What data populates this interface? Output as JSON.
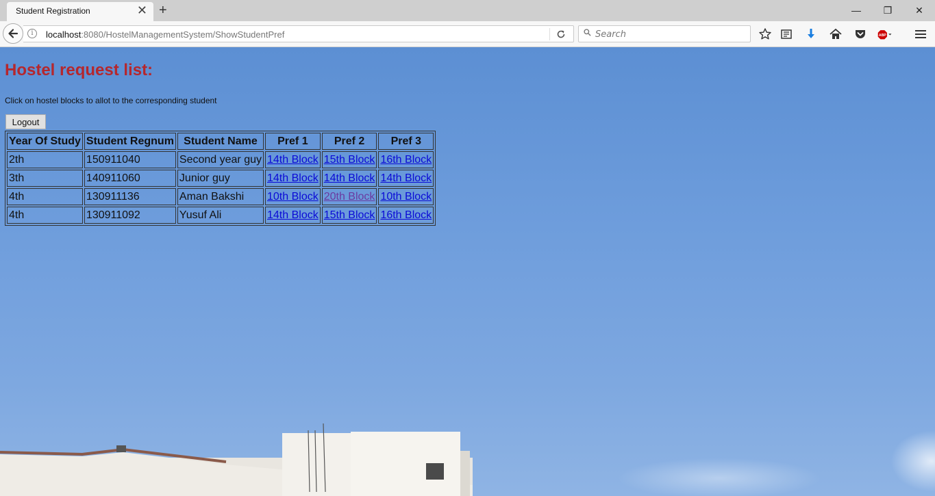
{
  "browser": {
    "tab_title": "Student Registration",
    "tab_close": "✕",
    "new_tab": "+",
    "window_controls": {
      "minimize": "—",
      "restore": "❐",
      "close": "✕"
    },
    "url_host": "localhost",
    "url_rest": ":8080/HostelManagementSystem/ShowStudentPref",
    "search_placeholder": "Search",
    "toolbar_icons": [
      "bookmark-star-icon",
      "reading-list-icon",
      "download-icon",
      "home-icon",
      "pocket-icon",
      "adblock-plus-icon",
      "menu-icon"
    ]
  },
  "page": {
    "title": "Hostel request list:",
    "instructions": "Click on hostel blocks to allot to the corresponding student",
    "logout_label": "Logout",
    "table": {
      "headers": [
        "Year Of Study",
        "Student Regnum",
        "Student Name",
        "Pref 1",
        "Pref 2",
        "Pref 3"
      ],
      "rows": [
        {
          "year": "2th",
          "regnum": "150911040",
          "name": "Second year guy",
          "pref1": "14th Block",
          "pref2": "15th Block",
          "pref3": "16th Block"
        },
        {
          "year": "3th",
          "regnum": "140911060",
          "name": "Junior guy",
          "pref1": "14th Block",
          "pref2": "14th Block",
          "pref3": "14th Block"
        },
        {
          "year": "4th",
          "regnum": "130911136",
          "name": "Aman Bakshi",
          "pref1": "10th Block",
          "pref2": "20th Block",
          "pref3": "10th Block"
        },
        {
          "year": "4th",
          "regnum": "130911092",
          "name": "Yusuf Ali",
          "pref1": "14th Block",
          "pref2": "15th Block",
          "pref3": "16th Block"
        }
      ]
    }
  },
  "colors": {
    "title": "#b5272d",
    "link": "#0b0bd6",
    "visited_link": "#6b3aa0",
    "sky": "#6e9ddc"
  }
}
